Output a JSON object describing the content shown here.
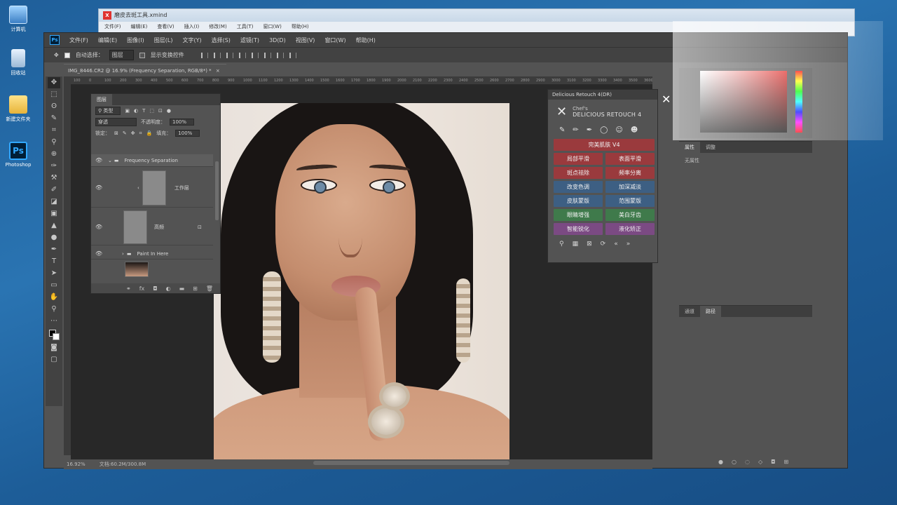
{
  "desktop": {
    "icons": [
      {
        "label": "计算机",
        "icon": "computer-icon"
      },
      {
        "label": "回收站",
        "icon": "recycle-bin-icon"
      },
      {
        "label": "新建文件夹",
        "icon": "folder-icon"
      },
      {
        "label": "Photoshop",
        "icon": "photoshop-icon"
      }
    ]
  },
  "xmind": {
    "title": "磨皮去斑工具.xmind",
    "menu": [
      "文件(F)",
      "编辑(E)",
      "查看(V)",
      "插入(I)",
      "修改(M)",
      "工具(T)",
      "窗口(W)",
      "帮助(H)"
    ]
  },
  "photoshop": {
    "menu": [
      "文件(F)",
      "编辑(E)",
      "图像(I)",
      "图层(L)",
      "文字(Y)",
      "选择(S)",
      "滤镜(T)",
      "3D(D)",
      "视图(V)",
      "窗口(W)",
      "帮助(H)"
    ],
    "options": {
      "auto_select_label": "自动选择：",
      "auto_select_value": "图层",
      "show_transform_label": "显示变换控件"
    },
    "document_tab": "IMG_8446.CR2 @ 16.9% (Frequency Separation, RGB/8*) *",
    "ruler_marks": [
      "100",
      "0",
      "100",
      "200",
      "300",
      "400",
      "500",
      "600",
      "700",
      "800",
      "900",
      "1000",
      "1100",
      "1200",
      "1300",
      "1400",
      "1500",
      "1600",
      "1700",
      "1800",
      "1900",
      "2000",
      "2100",
      "2200",
      "2300",
      "2400",
      "2500",
      "2600",
      "2700",
      "2800",
      "2900",
      "3000",
      "3100",
      "3200",
      "3300",
      "3400",
      "3500",
      "3600",
      "3700"
    ],
    "status": {
      "zoom": "16.92%",
      "doc_size": "文档:60.2M/300.8M"
    }
  },
  "layers_panel": {
    "tab": "图层",
    "filter_kind": "类型",
    "blend_mode": "穿透",
    "opacity_label": "不透明度：",
    "opacity_value": "100%",
    "lock_label": "锁定：",
    "fill_label": "填充：",
    "fill_value": "100%",
    "layers": [
      {
        "name": "Frequency Separation",
        "type": "group"
      },
      {
        "name": "工作层",
        "type": "layer"
      },
      {
        "name": "高频",
        "type": "layer"
      },
      {
        "name": "Paint In Here",
        "type": "group"
      },
      {
        "name": "",
        "type": "photo"
      }
    ]
  },
  "delicious_panel": {
    "title": "Delicious Retouch 4(DR)",
    "brand_line1": "Chef's",
    "brand_line2": "DELICIOUS RETOUCH 4",
    "buttons": [
      {
        "label": "完美肌肤 V4",
        "color": "red",
        "wide": true
      },
      {
        "label": "局部平滑",
        "color": "red"
      },
      {
        "label": "表面平滑",
        "color": "red"
      },
      {
        "label": "斑点祛除",
        "color": "red"
      },
      {
        "label": "频率分离",
        "color": "red"
      },
      {
        "label": "改变色调",
        "color": "blue"
      },
      {
        "label": "加深减淡",
        "color": "blue"
      },
      {
        "label": "皮肤蒙版",
        "color": "blue"
      },
      {
        "label": "范围蒙版",
        "color": "blue"
      },
      {
        "label": "眼睛增强",
        "color": "green"
      },
      {
        "label": "美白牙齿",
        "color": "green"
      },
      {
        "label": "智能锐化",
        "color": "purple"
      },
      {
        "label": "液化矫正",
        "color": "purple"
      }
    ]
  },
  "properties_panel": {
    "tabs": [
      "属性",
      "调整"
    ],
    "body": "无属性"
  },
  "paths_panel": {
    "tabs": [
      "通道",
      "路径"
    ]
  },
  "colors": {
    "ps_bg": "#535353",
    "ps_dark": "#424242",
    "accent_ps": "#31a8ff"
  }
}
